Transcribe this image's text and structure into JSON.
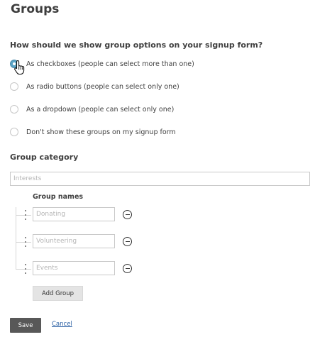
{
  "page": {
    "title": "Groups"
  },
  "display": {
    "question": "How should we show group options on your signup form?",
    "options": [
      {
        "label": "As checkboxes (people can select more than one)",
        "selected": true
      },
      {
        "label": "As radio buttons (people can select only one)",
        "selected": false
      },
      {
        "label": "As a dropdown (people can select only one)",
        "selected": false
      },
      {
        "label": "Don't show these groups on my signup form",
        "selected": false
      }
    ]
  },
  "category": {
    "label": "Group category",
    "value": "",
    "placeholder": "Interests"
  },
  "group_names": {
    "label": "Group names",
    "items": [
      {
        "value": "",
        "placeholder": "Donating"
      },
      {
        "value": "",
        "placeholder": "Volunteering"
      },
      {
        "value": "",
        "placeholder": "Events"
      }
    ],
    "add_label": "Add Group"
  },
  "actions": {
    "save_label": "Save",
    "cancel_label": "Cancel"
  },
  "colors": {
    "radio_selected": "#5aa3c4",
    "save_button": "#585858",
    "link": "#2a5fa3"
  }
}
